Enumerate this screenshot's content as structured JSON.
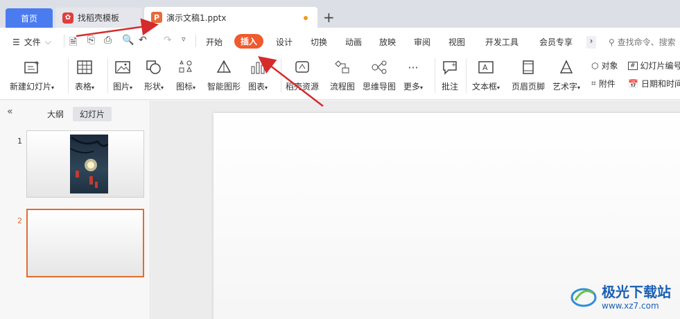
{
  "titlebar": {
    "tabs": [
      {
        "label": "首页"
      },
      {
        "label": "找稻壳模板"
      },
      {
        "label": "演示文稿1.pptx"
      }
    ],
    "new_tab": "+"
  },
  "menubar": {
    "file_label": "文件",
    "items": [
      "开始",
      "插入",
      "设计",
      "切换",
      "动画",
      "放映",
      "审阅",
      "视图",
      "开发工具",
      "会员专享"
    ],
    "active": "插入",
    "search_placeholder": "查找命令、搜索"
  },
  "toolbar": {
    "new_slide": "新建幻灯片",
    "table": "表格",
    "picture": "图片",
    "shape": "形状",
    "icon": "图标",
    "smart_shape": "智能图形",
    "chart": "图表",
    "resource": "稻壳资源",
    "flowchart": "流程图",
    "mindmap": "思维导图",
    "more": "更多",
    "comment": "批注",
    "textbox": "文本框",
    "header_footer": "页眉页脚",
    "wordart": "艺术字",
    "object": "对象",
    "attachment": "附件",
    "slide_number": "幻灯片编号",
    "datetime": "日期和时间"
  },
  "leftpanel": {
    "outline": "大纲",
    "slides": "幻灯片",
    "thumbs": [
      "1",
      "2"
    ]
  },
  "watermark": {
    "main": "极光下载站",
    "url": "www.xz7.com"
  },
  "colors": {
    "accent": "#ef5a2e",
    "home_tab": "#4a7cf0",
    "arrow": "#d62b2b"
  }
}
